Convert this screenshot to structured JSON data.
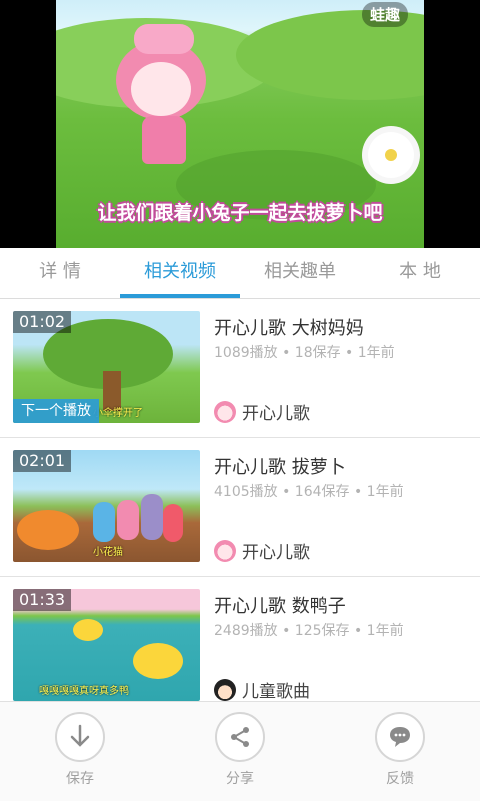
{
  "player": {
    "brand_logo": "蛙趣",
    "subtitle": "让我们跟着小兔子一起去拔萝卜吧"
  },
  "tabs": [
    {
      "label": "详 情",
      "active": false
    },
    {
      "label": "相关视频",
      "active": true
    },
    {
      "label": "相关趣单",
      "active": false
    },
    {
      "label": "本 地",
      "active": false
    }
  ],
  "accent_color": "#2b9bd8",
  "videos": [
    {
      "duration": "01:02",
      "badge": "下一个播放",
      "thumb_caption": "小伞撑开了",
      "title": "开心儿歌 大树妈妈",
      "meta": "1089播放 • 18保存 • 1年前",
      "channel": "开心儿歌",
      "avatar_icon": "bunny-avatar-icon"
    },
    {
      "duration": "02:01",
      "thumb_caption": "小花猫",
      "title": "开心儿歌 拔萝卜",
      "meta": "4105播放 • 164保存 • 1年前",
      "channel": "开心儿歌",
      "avatar_icon": "bunny-avatar-icon"
    },
    {
      "duration": "01:33",
      "thumb_caption": "嘎嘎嘎嘎真呀真多鸭",
      "title": "开心儿歌 数鸭子",
      "meta": "2489播放 • 125保存 • 1年前",
      "channel": "儿童歌曲",
      "avatar_icon": "kid-avatar-icon"
    }
  ],
  "actions": {
    "save": {
      "label": "保存",
      "icon": "download-icon"
    },
    "share": {
      "label": "分享",
      "icon": "share-icon"
    },
    "feedback": {
      "label": "反馈",
      "icon": "chat-bubble-icon"
    }
  }
}
